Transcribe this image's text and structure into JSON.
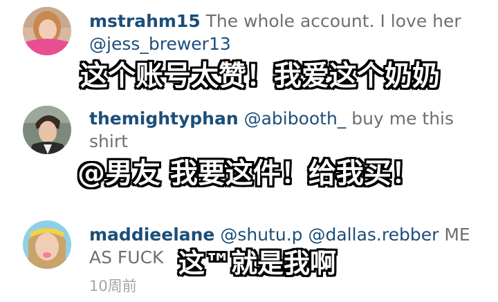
{
  "comments": [
    {
      "username": "mstrahm15",
      "text": " The whole account. I love her ",
      "mentions": [
        "@jess_brewer13"
      ],
      "caption": "这个账号太赞！我爱这个奶奶"
    },
    {
      "username": "themightyphan",
      "mentions": [
        "@abibooth_"
      ],
      "text": " buy me this shirt",
      "caption": "@男友 我要这件！给我买！"
    },
    {
      "username": "maddieelane",
      "mentions": [
        "@shutu.p",
        "@dallas.rebber"
      ],
      "text": " ME AS FUCK",
      "caption": "这™就是我啊",
      "timestamp": "10周前"
    }
  ],
  "colors": {
    "username": "#1c4e7a",
    "body_text": "#6f6f6f",
    "timestamp": "#a4a4a4",
    "caption_fill": "#ffffff",
    "caption_outline": "#000000"
  }
}
